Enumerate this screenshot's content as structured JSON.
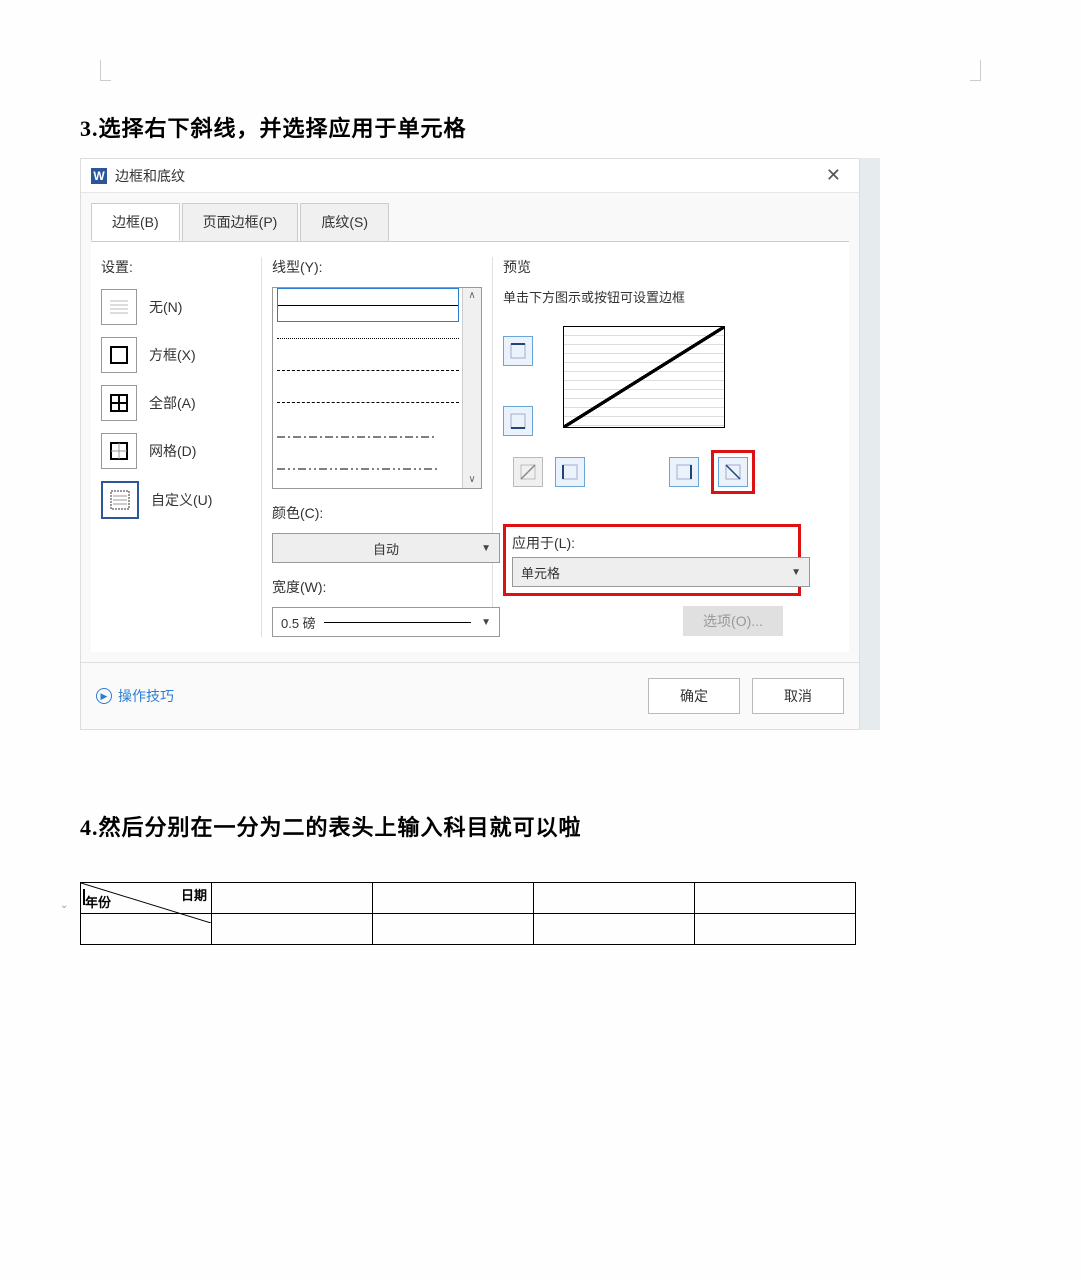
{
  "step3_heading": "3.选择右下斜线，并选择应用于单元格",
  "step4_heading": "4.然后分别在一分为二的表头上输入科目就可以啦",
  "dialog": {
    "app_icon_letter": "W",
    "title": "边框和底纹",
    "tabs": {
      "border": "边框(B)",
      "page_border": "页面边框(P)",
      "shading": "底纹(S)"
    },
    "settings_label": "设置:",
    "settings": {
      "none": "无(N)",
      "box": "方框(X)",
      "all": "全部(A)",
      "grid": "网格(D)",
      "custom": "自定义(U)"
    },
    "linetype_label": "线型(Y):",
    "color_label": "颜色(C):",
    "color_value": "自动",
    "width_label": "宽度(W):",
    "width_value": "0.5  磅",
    "preview_label": "预览",
    "preview_hint": "单击下方图示或按钮可设置边框",
    "applyto_label": "应用于(L):",
    "applyto_value": "单元格",
    "options_btn": "选项(O)...",
    "tips_link": "操作技巧",
    "ok_btn": "确定",
    "cancel_btn": "取消"
  },
  "table": {
    "header_tr": "日期",
    "header_bl": "年份"
  }
}
